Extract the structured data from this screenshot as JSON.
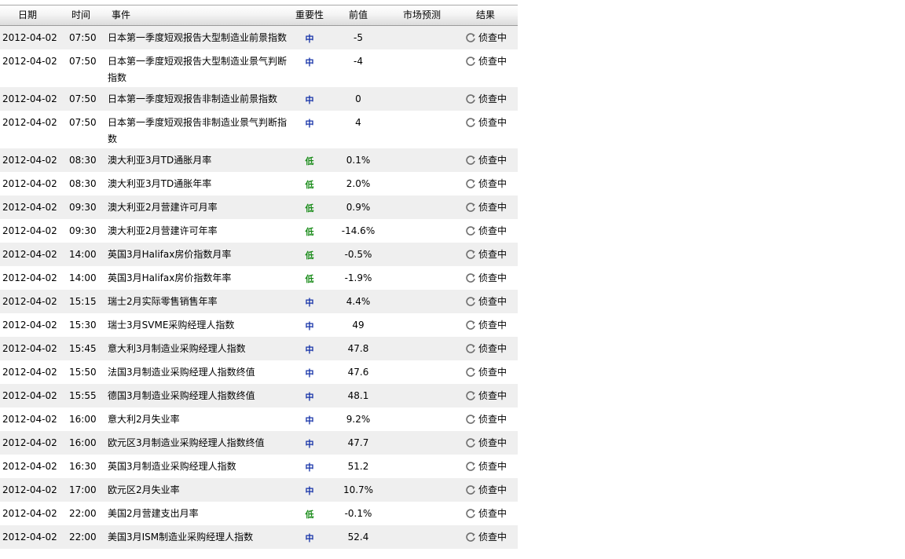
{
  "headers": {
    "date": "日期",
    "time": "时间",
    "event": "事件",
    "importance": "重要性",
    "previous": "前值",
    "forecast": "市场预测",
    "result": "结果"
  },
  "colors": {
    "importance_mid": "#1633a8",
    "importance_low": "#178a17"
  },
  "rows": [
    {
      "date": "2012-04-02",
      "time": "07:50",
      "event": "日本第一季度短观报告大型制造业前景指数",
      "importance": "中",
      "level": "mid",
      "previous": "-5",
      "forecast": "",
      "result": "侦查中",
      "result_icon": "refresh-icon",
      "tall": false
    },
    {
      "date": "2012-04-02",
      "time": "07:50",
      "event": "日本第一季度短观报告大型制造业景气判断指数",
      "importance": "中",
      "level": "mid",
      "previous": "-4",
      "forecast": "",
      "result": "侦查中",
      "result_icon": "refresh-icon",
      "tall": true
    },
    {
      "date": "2012-04-02",
      "time": "07:50",
      "event": "日本第一季度短观报告非制造业前景指数",
      "importance": "中",
      "level": "mid",
      "previous": "0",
      "forecast": "",
      "result": "侦查中",
      "result_icon": "refresh-icon",
      "tall": false
    },
    {
      "date": "2012-04-02",
      "time": "07:50",
      "event": "日本第一季度短观报告非制造业景气判断指数",
      "importance": "中",
      "level": "mid",
      "previous": "4",
      "forecast": "",
      "result": "侦查中",
      "result_icon": "refresh-icon",
      "tall": true
    },
    {
      "date": "2012-04-02",
      "time": "08:30",
      "event": "澳大利亚3月TD通胀月率",
      "importance": "低",
      "level": "low",
      "previous": "0.1%",
      "forecast": "",
      "result": "侦查中",
      "result_icon": "refresh-icon",
      "tall": false
    },
    {
      "date": "2012-04-02",
      "time": "08:30",
      "event": "澳大利亚3月TD通胀年率",
      "importance": "低",
      "level": "low",
      "previous": "2.0%",
      "forecast": "",
      "result": "侦查中",
      "result_icon": "refresh-icon",
      "tall": false
    },
    {
      "date": "2012-04-02",
      "time": "09:30",
      "event": "澳大利亚2月营建许可月率",
      "importance": "低",
      "level": "low",
      "previous": "0.9%",
      "forecast": "",
      "result": "侦查中",
      "result_icon": "refresh-icon",
      "tall": false
    },
    {
      "date": "2012-04-02",
      "time": "09:30",
      "event": "澳大利亚2月营建许可年率",
      "importance": "低",
      "level": "low",
      "previous": "-14.6%",
      "forecast": "",
      "result": "侦查中",
      "result_icon": "refresh-icon",
      "tall": false
    },
    {
      "date": "2012-04-02",
      "time": "14:00",
      "event": "英国3月Halifax房价指数月率",
      "importance": "低",
      "level": "low",
      "previous": "-0.5%",
      "forecast": "",
      "result": "侦查中",
      "result_icon": "refresh-icon",
      "tall": false
    },
    {
      "date": "2012-04-02",
      "time": "14:00",
      "event": "英国3月Halifax房价指数年率",
      "importance": "低",
      "level": "low",
      "previous": "-1.9%",
      "forecast": "",
      "result": "侦查中",
      "result_icon": "refresh-icon",
      "tall": false
    },
    {
      "date": "2012-04-02",
      "time": "15:15",
      "event": "瑞士2月实际零售销售年率",
      "importance": "中",
      "level": "mid",
      "previous": "4.4%",
      "forecast": "",
      "result": "侦查中",
      "result_icon": "refresh-icon",
      "tall": false
    },
    {
      "date": "2012-04-02",
      "time": "15:30",
      "event": "瑞士3月SVME采购经理人指数",
      "importance": "中",
      "level": "mid",
      "previous": "49",
      "forecast": "",
      "result": "侦查中",
      "result_icon": "refresh-icon",
      "tall": false
    },
    {
      "date": "2012-04-02",
      "time": "15:45",
      "event": "意大利3月制造业采购经理人指数",
      "importance": "中",
      "level": "mid",
      "previous": "47.8",
      "forecast": "",
      "result": "侦查中",
      "result_icon": "refresh-icon",
      "tall": false
    },
    {
      "date": "2012-04-02",
      "time": "15:50",
      "event": "法国3月制造业采购经理人指数终值",
      "importance": "中",
      "level": "mid",
      "previous": "47.6",
      "forecast": "",
      "result": "侦查中",
      "result_icon": "refresh-icon",
      "tall": false
    },
    {
      "date": "2012-04-02",
      "time": "15:55",
      "event": "德国3月制造业采购经理人指数终值",
      "importance": "中",
      "level": "mid",
      "previous": "48.1",
      "forecast": "",
      "result": "侦查中",
      "result_icon": "refresh-icon",
      "tall": false
    },
    {
      "date": "2012-04-02",
      "time": "16:00",
      "event": "意大利2月失业率",
      "importance": "中",
      "level": "mid",
      "previous": "9.2%",
      "forecast": "",
      "result": "侦查中",
      "result_icon": "refresh-icon",
      "tall": false
    },
    {
      "date": "2012-04-02",
      "time": "16:00",
      "event": "欧元区3月制造业采购经理人指数终值",
      "importance": "中",
      "level": "mid",
      "previous": "47.7",
      "forecast": "",
      "result": "侦查中",
      "result_icon": "refresh-icon",
      "tall": false
    },
    {
      "date": "2012-04-02",
      "time": "16:30",
      "event": "英国3月制造业采购经理人指数",
      "importance": "中",
      "level": "mid",
      "previous": "51.2",
      "forecast": "",
      "result": "侦查中",
      "result_icon": "refresh-icon",
      "tall": false
    },
    {
      "date": "2012-04-02",
      "time": "17:00",
      "event": "欧元区2月失业率",
      "importance": "中",
      "level": "mid",
      "previous": "10.7%",
      "forecast": "",
      "result": "侦查中",
      "result_icon": "refresh-icon",
      "tall": false
    },
    {
      "date": "2012-04-02",
      "time": "22:00",
      "event": "美国2月营建支出月率",
      "importance": "低",
      "level": "low",
      "previous": "-0.1%",
      "forecast": "",
      "result": "侦查中",
      "result_icon": "refresh-icon",
      "tall": false
    },
    {
      "date": "2012-04-02",
      "time": "22:00",
      "event": "美国3月ISM制造业采购经理人指数",
      "importance": "中",
      "level": "mid",
      "previous": "52.4",
      "forecast": "",
      "result": "侦查中",
      "result_icon": "refresh-icon",
      "tall": false
    }
  ]
}
